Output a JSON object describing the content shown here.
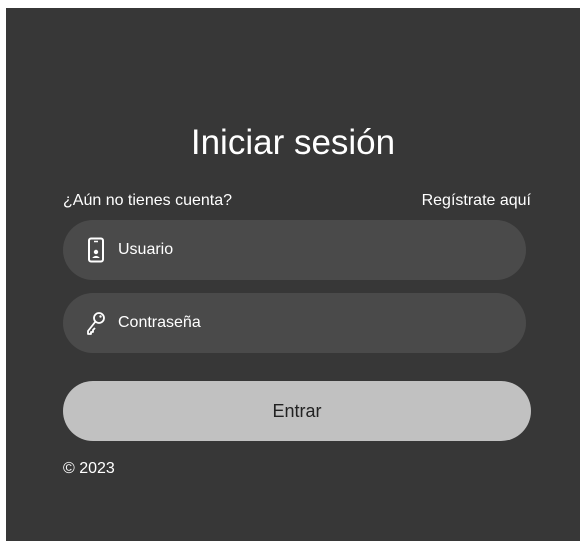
{
  "login": {
    "title": "Iniciar sesión",
    "signup_question": "¿Aún no tienes cuenta?",
    "signup_link": "Regístrate aquí",
    "username": {
      "placeholder": "Usuario",
      "icon": "phone-user-icon"
    },
    "password": {
      "placeholder": "Contraseña",
      "icon": "key-icon"
    },
    "submit_label": "Entrar",
    "footer": "© 2023"
  },
  "colors": {
    "panel_background": "#373737",
    "field_background": "#4a4a4a",
    "button_background": "#c1c1c1",
    "text": "#ffffff"
  }
}
